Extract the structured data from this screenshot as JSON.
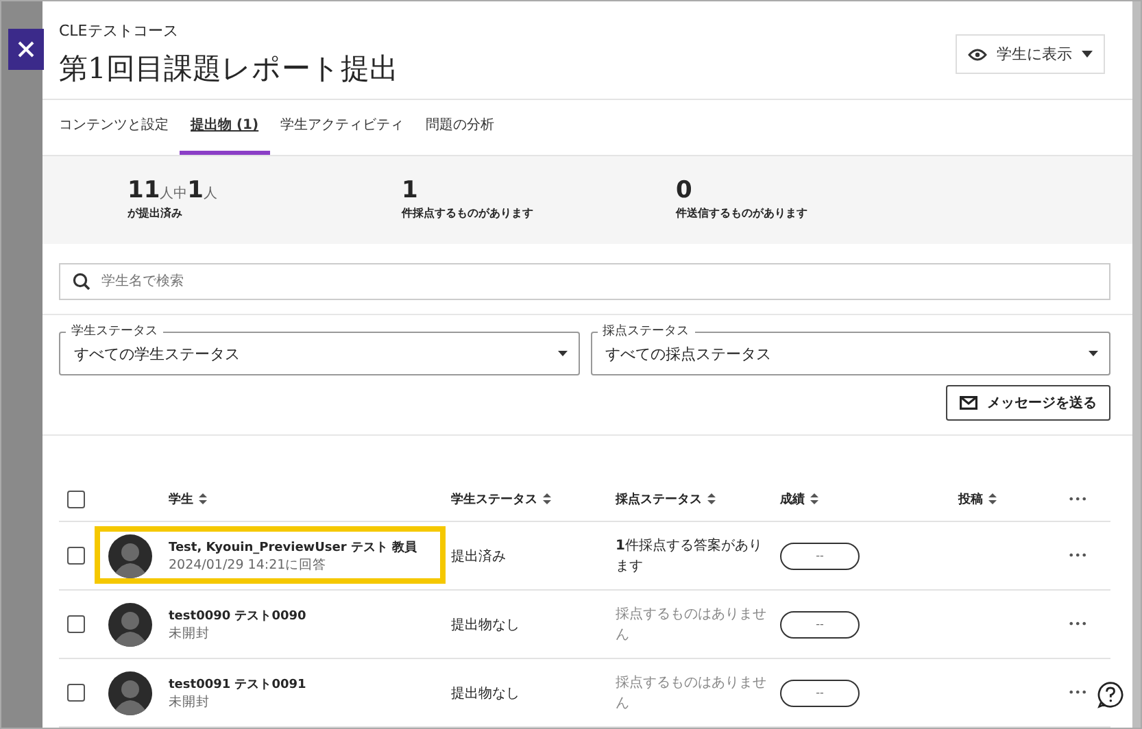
{
  "course": "CLEテストコース",
  "title": "第1回目課題レポート提出",
  "visibility_button": "学生に表示",
  "tabs": [
    {
      "label": "コンテンツと設定",
      "selected": false
    },
    {
      "label": "提出物 (1)",
      "selected": true
    },
    {
      "label": "学生アクティビティ",
      "selected": false
    },
    {
      "label": "問題の分析",
      "selected": false
    }
  ],
  "stats": [
    {
      "parts": [
        {
          "kind": "number",
          "text": "11"
        },
        {
          "kind": "unit",
          "text": "人中"
        },
        {
          "kind": "number",
          "text": "1"
        },
        {
          "kind": "unit",
          "text": "人"
        }
      ],
      "label": "が提出済み"
    },
    {
      "parts": [
        {
          "kind": "number",
          "text": "1"
        }
      ],
      "label": "件採点するものがあります"
    },
    {
      "parts": [
        {
          "kind": "number",
          "text": "0"
        }
      ],
      "label": "件送信するものがあります"
    }
  ],
  "search": {
    "placeholder": "学生名で検索"
  },
  "filters": [
    {
      "label": "学生ステータス",
      "value": "すべての学生ステータス"
    },
    {
      "label": "採点ステータス",
      "value": "すべての採点ステータス"
    }
  ],
  "message_button": "メッセージを送る",
  "table": {
    "select_all": {
      "checked": false
    },
    "columns": [
      "学生",
      "学生ステータス",
      "採点ステータス",
      "成績",
      "投稿"
    ],
    "more": "•••",
    "rows": [
      {
        "checked": false,
        "highlighted": true,
        "name": "Test, Kyouin_PreviewUser テスト 教員",
        "subtitle": "2024/01/29 14:21に回答",
        "student_status": "提出済み",
        "grading_status": "**1**件採点する答案があります",
        "needs_grading": true,
        "grade": "--",
        "more": "•••"
      },
      {
        "checked": false,
        "highlighted": false,
        "name": "test0090 テスト0090",
        "subtitle": "未開封",
        "student_status": "提出物なし",
        "grading_status": "採点するものはありません",
        "needs_grading": false,
        "grade": "--",
        "more": "•••"
      },
      {
        "checked": false,
        "highlighted": false,
        "name": "test0091 テスト0091",
        "subtitle": "未開封",
        "student_status": "提出物なし",
        "grading_status": "採点するものはありません",
        "needs_grading": false,
        "grade": "--",
        "more": "•••"
      }
    ]
  }
}
